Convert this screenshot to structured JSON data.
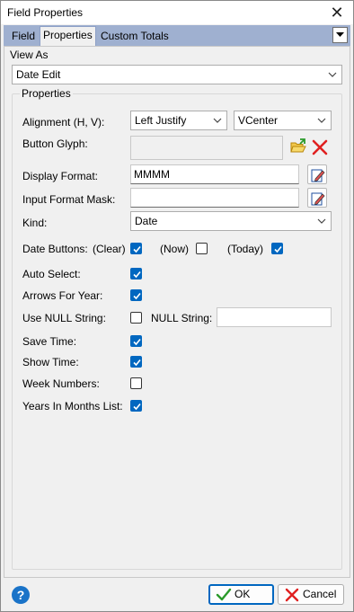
{
  "window": {
    "title": "Field Properties",
    "close_icon": "close-icon"
  },
  "tabs": [
    {
      "label": "Field",
      "active": false
    },
    {
      "label": "Properties",
      "active": true
    },
    {
      "label": "Custom Totals",
      "active": false
    }
  ],
  "view_as": {
    "label": "View As",
    "value": "Date Edit"
  },
  "properties": {
    "legend": "Properties",
    "alignment": {
      "label": "Alignment (H, V):",
      "horizontal": "Left Justify",
      "vertical": "VCenter"
    },
    "button_glyph": {
      "label": "Button Glyph:",
      "value": ""
    },
    "display_format": {
      "label": "Display Format:",
      "value": "MMMM"
    },
    "input_format_mask": {
      "label": "Input Format Mask:",
      "value": ""
    },
    "kind": {
      "label": "Kind:",
      "value": "Date"
    },
    "date_buttons": {
      "label": "Date Buttons:",
      "clear": {
        "label": "(Clear)",
        "checked": true
      },
      "now": {
        "label": "(Now)",
        "checked": false
      },
      "today": {
        "label": "(Today)",
        "checked": true
      }
    },
    "auto_select": {
      "label": "Auto Select:",
      "checked": true
    },
    "arrows_for_year": {
      "label": "Arrows For Year:",
      "checked": true
    },
    "use_null_string": {
      "label": "Use NULL String:",
      "checked": false
    },
    "null_string": {
      "label": "NULL String:",
      "value": ""
    },
    "save_time": {
      "label": "Save Time:",
      "checked": true
    },
    "show_time": {
      "label": "Show Time:",
      "checked": true
    },
    "week_numbers": {
      "label": "Week Numbers:",
      "checked": false
    },
    "years_in_months_list": {
      "label": "Years In Months List:",
      "checked": true
    }
  },
  "footer": {
    "ok_label": "OK",
    "cancel_label": "Cancel",
    "help_label": "?"
  },
  "colors": {
    "accent": "#0067c0",
    "tab_strip": "#9fb0d0",
    "dialog_bg": "#f0f0f0",
    "cancel_red": "#e02020",
    "ok_green": "#2a9a2a"
  }
}
